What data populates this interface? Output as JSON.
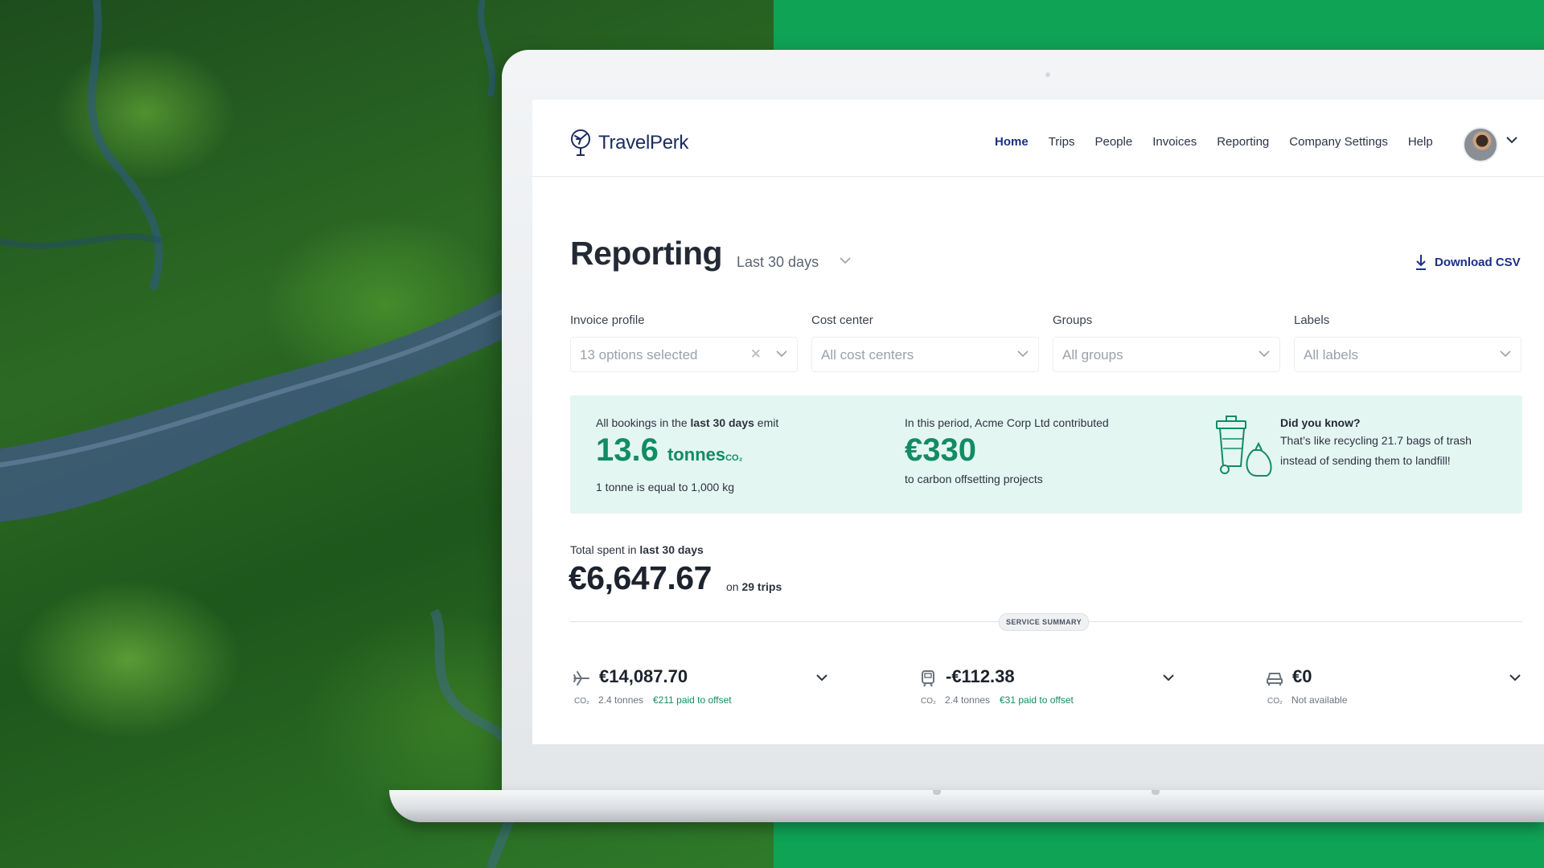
{
  "brand": {
    "name": "TravelPerk",
    "accent": "#1b2f86",
    "green": "#128c62",
    "background_green": "#0fa356"
  },
  "nav": {
    "items": [
      {
        "label": "Home",
        "active": true
      },
      {
        "label": "Trips"
      },
      {
        "label": "People"
      },
      {
        "label": "Invoices"
      },
      {
        "label": "Reporting"
      },
      {
        "label": "Company Settings"
      },
      {
        "label": "Help"
      }
    ]
  },
  "page": {
    "title": "Reporting",
    "period": "Last 30 days",
    "download_label": "Download CSV"
  },
  "filters": [
    {
      "label": "Invoice profile",
      "value": "13 options selected",
      "clearable": true
    },
    {
      "label": "Cost center",
      "value": "All cost centers"
    },
    {
      "label": "Groups",
      "value": "All groups"
    },
    {
      "label": "Labels",
      "value": "All labels"
    }
  ],
  "emissions": {
    "intro_pre": "All bookings in the ",
    "intro_bold": "last 30 days",
    "intro_post": " emit",
    "amount": "13.6",
    "unit": "tonnes",
    "unit_sub": "CO₂",
    "note": "1 tonne is equal to 1,000 kg"
  },
  "contribution": {
    "intro": "In this period, Acme Corp Ltd contributed",
    "amount": "€330",
    "note": "to carbon offsetting projects"
  },
  "tip": {
    "heading": "Did you know?",
    "body": "That’s like recycling 21.7 bags of trash instead of sending them to landfill!"
  },
  "spending": {
    "label_pre": "Total spent in ",
    "label_bold": "last 30 days",
    "amount": "€6,647.67",
    "trips_pre": "on ",
    "trips_bold": "29 trips"
  },
  "service_summary": {
    "label": "SERVICE SUMMARY",
    "items": [
      {
        "icon": "plane-icon",
        "amount": "€14,087.70",
        "co2": "CO₂",
        "tonnes": "2.4 tonnes",
        "offset": "€211 paid to offset"
      },
      {
        "icon": "train-icon",
        "amount": "-€112.38",
        "co2": "CO₂",
        "tonnes": "2.4 tonnes",
        "offset": "€31 paid to offset"
      },
      {
        "icon": "car-icon",
        "amount": "€0",
        "co2": "CO₂",
        "tonnes": "Not available",
        "offset": ""
      }
    ]
  }
}
